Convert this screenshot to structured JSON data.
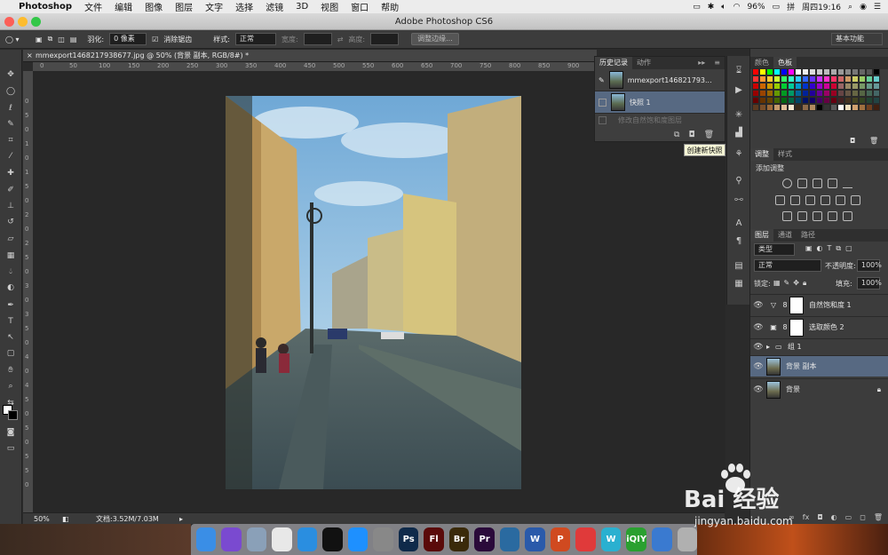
{
  "menubar": {
    "apple": "",
    "app_name": "Photoshop",
    "items": [
      "文件",
      "编辑",
      "图像",
      "图层",
      "文字",
      "选择",
      "滤镜",
      "3D",
      "视图",
      "窗口",
      "帮助"
    ],
    "battery": "96%",
    "clock": "周四19:16"
  },
  "window": {
    "title": "Adobe Photoshop CS6"
  },
  "options": {
    "feather_label": "羽化:",
    "feather_value": "0 像素",
    "antialias_label": "消除锯齿",
    "style_label": "样式:",
    "style_value": "正常",
    "width_label": "宽度:",
    "height_label": "高度:",
    "refine_edge": "调整边缘...",
    "workspace": "基本功能"
  },
  "document": {
    "tab_title": "mmexport1468217938677.jpg @ 50% (背景 副本, RGB/8#) *",
    "ruler_h": [
      "0",
      "50",
      "100",
      "150",
      "200",
      "250",
      "300",
      "350",
      "400",
      "450",
      "500",
      "550",
      "600",
      "650",
      "700",
      "750",
      "800",
      "850",
      "900",
      "950"
    ],
    "ruler_v": [
      "0",
      "5",
      "0",
      "1",
      "0",
      "1",
      "5",
      "0",
      "2",
      "0",
      "2",
      "5",
      "0",
      "3",
      "0",
      "3",
      "5",
      "0",
      "4",
      "0",
      "4",
      "5",
      "0",
      "5",
      "0",
      "5",
      "5",
      "0"
    ],
    "zoom": "50%",
    "doc_size": "文档:3.52M/7.03M"
  },
  "history_panel": {
    "tabs": [
      "历史记录",
      "动作"
    ],
    "items": [
      {
        "label": "mmexport146821793..."
      },
      {
        "label": "快照 1"
      }
    ],
    "state": "修改自然饱和度图层",
    "tooltip": "创建新快照"
  },
  "swatches_panel": {
    "tabs": [
      "颜色",
      "色板"
    ],
    "colors": [
      "#ff0000",
      "#ffff00",
      "#00ff00",
      "#00ffff",
      "#0000ff",
      "#ff00ff",
      "#ffffff",
      "#eeeeee",
      "#dddddd",
      "#cccccc",
      "#bbbbbb",
      "#aaaaaa",
      "#999999",
      "#888888",
      "#777777",
      "#666666",
      "#555555",
      "#000000",
      "#ff3333",
      "#ff9933",
      "#ffcc33",
      "#ccff33",
      "#33ff66",
      "#33ffcc",
      "#33ccff",
      "#3366ff",
      "#6633ff",
      "#cc33ff",
      "#ff33cc",
      "#ff3366",
      "#cc6666",
      "#cc9966",
      "#cccc66",
      "#99cc66",
      "#66cc99",
      "#66cccc",
      "#cc0000",
      "#cc6600",
      "#cc9900",
      "#99cc00",
      "#00cc33",
      "#00cc99",
      "#0099cc",
      "#0033cc",
      "#3300cc",
      "#9900cc",
      "#cc0099",
      "#cc0033",
      "#996666",
      "#998866",
      "#999966",
      "#779966",
      "#669988",
      "#669999",
      "#990000",
      "#994400",
      "#996600",
      "#669900",
      "#009922",
      "#009966",
      "#006699",
      "#002299",
      "#220099",
      "#660099",
      "#990066",
      "#990022",
      "#664444",
      "#665544",
      "#666644",
      "#556644",
      "#446655",
      "#446666",
      "#660000",
      "#663300",
      "#664400",
      "#446600",
      "#006611",
      "#006644",
      "#004466",
      "#001166",
      "#110066",
      "#440066",
      "#660044",
      "#660011",
      "#442222",
      "#443322",
      "#444422",
      "#334422",
      "#224433",
      "#224444",
      "#5c3a21",
      "#7a4f2a",
      "#9c6a3a",
      "#c49a6c",
      "#e0c09a",
      "#f5e6d0",
      "#3a2a1a",
      "#8a6a4a",
      "#b08a60",
      "#000000",
      "#333333",
      "#5a5a5a",
      "#ffffff",
      "#f0e0c0",
      "#d0a070",
      "#a07040",
      "#704020",
      "#402010"
    ]
  },
  "adjustments_panel": {
    "tabs": [
      "调整",
      "样式"
    ],
    "title": "添加调整"
  },
  "layers_panel": {
    "tabs": [
      "图层",
      "通道",
      "路径"
    ],
    "filter_label": "类型",
    "blend_mode": "正常",
    "opacity_label": "不透明度:",
    "opacity_value": "100%",
    "lock_label": "锁定:",
    "fill_label": "填充:",
    "fill_value": "100%",
    "layers": [
      {
        "name": "自然饱和度 1"
      },
      {
        "name": "选取颜色 2"
      },
      {
        "name": "组 1"
      },
      {
        "name": "背景 副本"
      },
      {
        "name": "背景"
      }
    ]
  },
  "dock": {
    "apps": [
      {
        "label": "",
        "color": "#3a8ee6"
      },
      {
        "label": "",
        "color": "#7a4ad0"
      },
      {
        "label": "",
        "color": "#8aa0b8"
      },
      {
        "label": "",
        "color": "#e8e8e8"
      },
      {
        "label": "",
        "color": "#2a8ee0"
      },
      {
        "label": "",
        "color": "#111111"
      },
      {
        "label": "",
        "color": "#1e90ff"
      },
      {
        "label": "",
        "color": "#888888"
      },
      {
        "label": "Ps",
        "color": "#0f2a4a"
      },
      {
        "label": "Fl",
        "color": "#5a0a0a"
      },
      {
        "label": "Br",
        "color": "#3a2a0a"
      },
      {
        "label": "Pr",
        "color": "#2a0a3a"
      },
      {
        "label": "",
        "color": "#2a6aa0"
      },
      {
        "label": "W",
        "color": "#2a5aaa"
      },
      {
        "label": "P",
        "color": "#d04a20"
      },
      {
        "label": "",
        "color": "#e03a3a"
      },
      {
        "label": "W",
        "color": "#2ab0d0"
      },
      {
        "label": "iQIY",
        "color": "#2aa030"
      },
      {
        "label": "",
        "color": "#3a7ad0"
      },
      {
        "label": "",
        "color": "#b0b0b0"
      }
    ]
  },
  "watermark": {
    "brand": "Bai 经验",
    "url": "jingyan.baidu.com"
  }
}
